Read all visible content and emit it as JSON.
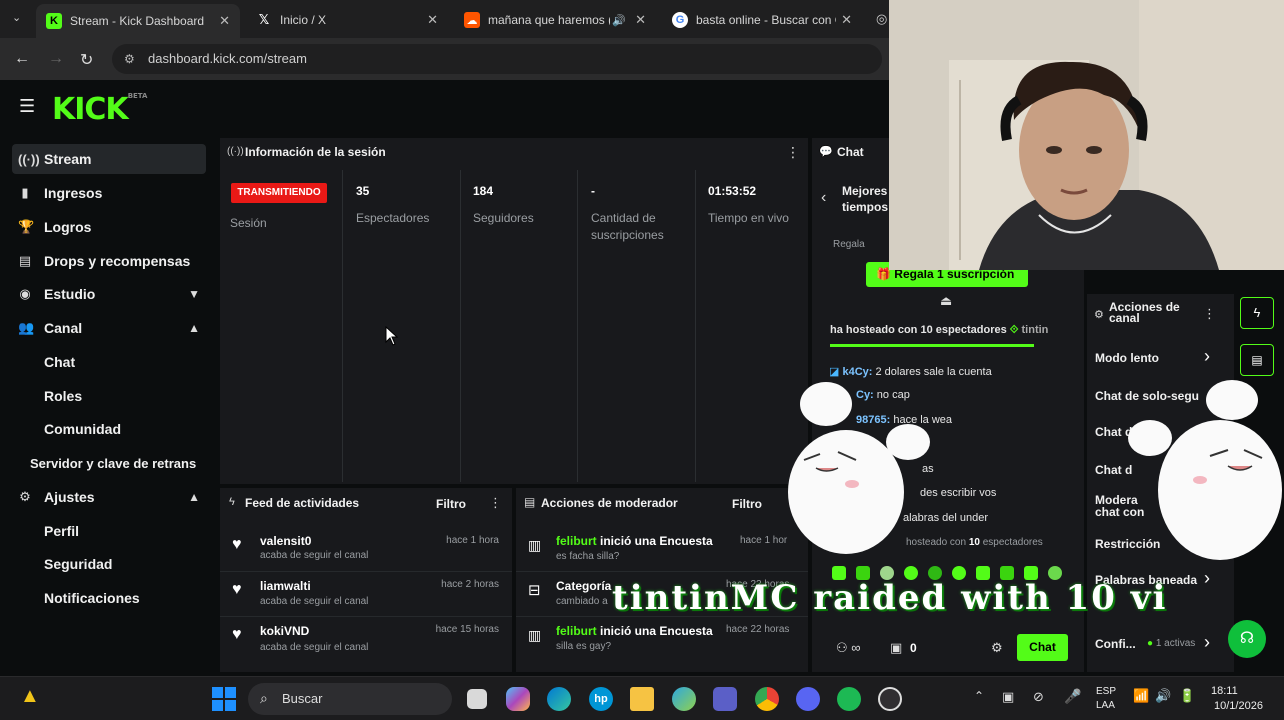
{
  "browser": {
    "tabs": [
      {
        "title": "Stream - Kick Dashboard",
        "active": true
      },
      {
        "title": "Inicio / X",
        "active": false
      },
      {
        "title": "mañana que haremos (p",
        "active": false
      },
      {
        "title": "basta online - Buscar con G",
        "active": false
      }
    ],
    "url": "dashboard.kick.com/stream"
  },
  "kick": {
    "logo": "KICK",
    "logo_badge": "BETA"
  },
  "sidebar": {
    "items": [
      {
        "label": "Stream",
        "icon": "broadcast-icon"
      },
      {
        "label": "Ingresos",
        "icon": "chart-icon"
      },
      {
        "label": "Logros",
        "icon": "trophy-icon"
      },
      {
        "label": "Drops y recompensas",
        "icon": "drops-icon"
      },
      {
        "label": "Estudio",
        "icon": "studio-icon"
      },
      {
        "label": "Canal",
        "icon": "users-icon"
      },
      {
        "label": "Chat"
      },
      {
        "label": "Roles"
      },
      {
        "label": "Comunidad"
      },
      {
        "label": "Servidor y clave de retrans"
      },
      {
        "label": "Ajustes",
        "icon": "gear-icon"
      },
      {
        "label": "Perfil"
      },
      {
        "label": "Seguridad"
      },
      {
        "label": "Notificaciones"
      }
    ]
  },
  "session": {
    "title": "Información de la sesión",
    "status_badge": "TRANSMITIENDO",
    "status_label": "Sesión",
    "stats": [
      {
        "value": "35",
        "label": "Espectadores"
      },
      {
        "value": "184",
        "label": "Seguidores"
      },
      {
        "value": "-",
        "label": "Cantidad de suscripciones"
      },
      {
        "value": "01:53:52",
        "label": "Tiempo en vivo"
      }
    ]
  },
  "feed": {
    "title": "Feed de actividades",
    "filter": "Filtro",
    "rows": [
      {
        "name": "valensit0",
        "sub": "acaba de seguir el canal",
        "time": "hace 1 hora"
      },
      {
        "name": "liamwalti",
        "sub": "acaba de seguir el canal",
        "time": "hace 2 horas"
      },
      {
        "name": "kokiVND",
        "sub": "acaba de seguir el canal",
        "time": "hace 15 horas"
      }
    ]
  },
  "moderator": {
    "title": "Acciones de moderador",
    "filter": "Filtro",
    "rows": [
      {
        "user": "feliburt",
        "action": "inició una Encuesta",
        "sub": "es facha silla?",
        "time": "hace 1 hor"
      },
      {
        "user": "",
        "action": "Categoría",
        "sub": "cambiado a",
        "time": "hace 22 horas"
      },
      {
        "user": "feliburt",
        "action": "inició una Encuesta",
        "sub": "silla es gay?",
        "time": "hace 22 horas"
      }
    ]
  },
  "chat": {
    "title": "Chat",
    "best_times": "Mejores tiempos",
    "gift_prefix": "Regala",
    "gift_button": "Regala 1 suscripción",
    "host_notice_a": "ha hosteado con",
    "host_notice_count": "10",
    "host_notice_b": "espectadores",
    "host_notice_user": "tintin",
    "messages": [
      {
        "user": "k4Cy:",
        "text": "2 dolares sale la cuenta"
      },
      {
        "user": "Cy:",
        "text": "no cap"
      },
      {
        "user": "98765:",
        "text": "hace la wea"
      },
      {
        "user": "",
        "text": "as"
      },
      {
        "user": "",
        "text": "des escribir vos"
      },
      {
        "user": "",
        "text": "alabras del under"
      }
    ],
    "host_notice2_a": "hosteado con",
    "host_notice2_count": "10",
    "host_notice2_b": "espectadores",
    "raid_overlay": "tintinMC raided with 10 vi",
    "viewer_count": "0",
    "send_button": "Chat"
  },
  "channel_actions": {
    "title": "Acciones de canal",
    "items": [
      "Modo lento",
      "Chat de solo-segu",
      "Chat de solo-",
      "Chat d",
      "Modera",
      "chat con",
      "Restricción",
      "Palabras baneada",
      "Confi..."
    ],
    "config_badge": "1 activas"
  },
  "taskbar": {
    "search": "Buscar",
    "lang_top": "ESP",
    "lang_bottom": "LAA",
    "time": "18:11",
    "date": "10/1/2026"
  },
  "colors": {
    "kick_green": "#53fc18",
    "live_red": "#e91916",
    "panel_bg": "#18191c"
  }
}
